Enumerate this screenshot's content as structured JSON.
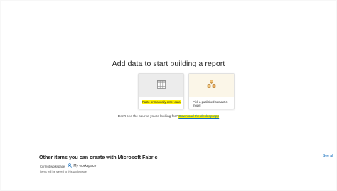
{
  "hero": {
    "title": "Add data to start building a report"
  },
  "cards": [
    {
      "label": "Paste or manually enter data",
      "icon": "table-grid-icon"
    },
    {
      "label": "Pick a published semantic model",
      "icon": "semantic-model-icon"
    }
  ],
  "source_prompt": {
    "text": "Don't see the source you're looking for?",
    "link": "Download the desktop app"
  },
  "fabric": {
    "title": "Other items you can create with Microsoft Fabric",
    "see_all": "See all",
    "workspace_label": "Current workspace:",
    "workspace_name": "My workspace",
    "workspace_icon": "person-icon",
    "note": "Items will be saved to this workspace."
  },
  "colors": {
    "highlight": "#fdf000",
    "link": "#0f6cbd"
  }
}
